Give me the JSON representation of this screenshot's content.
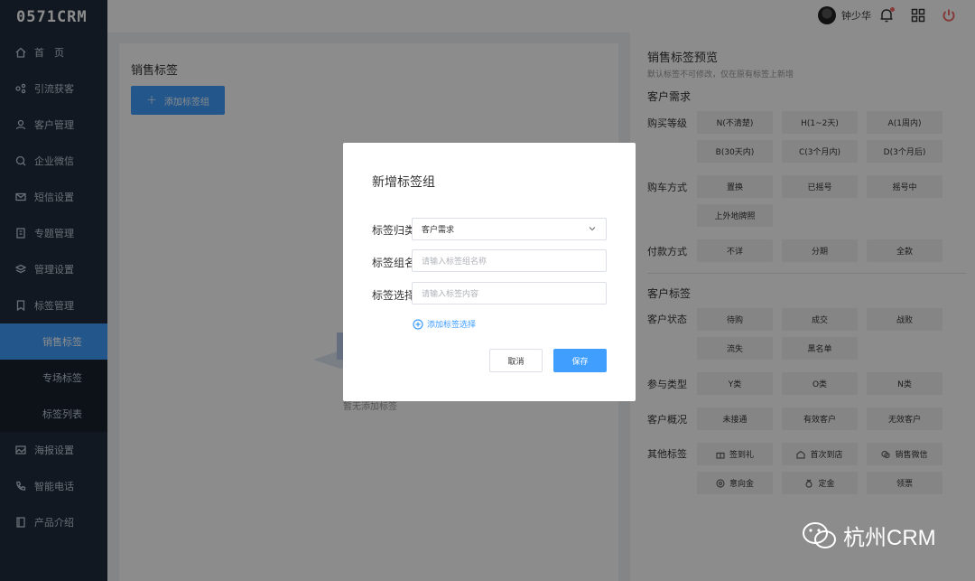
{
  "app": {
    "logo": "0571CRM"
  },
  "sidebar": {
    "items": [
      {
        "label": "首　页",
        "icon": "home-icon"
      },
      {
        "label": "引流获客",
        "icon": "share-icon"
      },
      {
        "label": "客户管理",
        "icon": "user-icon"
      },
      {
        "label": "企业微信",
        "icon": "chat-icon"
      },
      {
        "label": "短信设置",
        "icon": "mail-icon"
      },
      {
        "label": "专题管理",
        "icon": "doc-icon"
      },
      {
        "label": "管理设置",
        "icon": "layers-icon"
      },
      {
        "label": "标签管理",
        "icon": "tag-icon"
      }
    ],
    "submenu": [
      {
        "label": "销售标签",
        "active": true
      },
      {
        "label": "专场标签",
        "active": false
      },
      {
        "label": "标签列表",
        "active": false
      }
    ],
    "items_after": [
      {
        "label": "海报设置",
        "icon": "image-icon"
      },
      {
        "label": "智能电话",
        "icon": "phone-icon"
      },
      {
        "label": "产品介绍",
        "icon": "book-icon"
      }
    ]
  },
  "topbar": {
    "username": "钟少华"
  },
  "main": {
    "title": "销售标签",
    "add_group_label": "添加标签组",
    "empty_text": "暂无添加标签"
  },
  "preview": {
    "title": "销售标签预览",
    "subtitle": "默认标签不可修改，仅在原有标签上新增",
    "section1": "客户需求",
    "buy_level": {
      "label": "购买等级",
      "tags": [
        "N(不清楚)",
        "H(1~2天)",
        "A(1周内)",
        "B(30天内)",
        "C(3个月内)",
        "D(3个月后)"
      ]
    },
    "buy_method": {
      "label": "购车方式",
      "tags": [
        "置换",
        "已摇号",
        "摇号中",
        "上外地牌照"
      ]
    },
    "pay_method": {
      "label": "付款方式",
      "tags": [
        "不详",
        "分期",
        "全款"
      ]
    },
    "section2": "客户标签",
    "cust_status": {
      "label": "客户状态",
      "tags": [
        "待购",
        "成交",
        "战败",
        "流失",
        "黑名单"
      ]
    },
    "join_type": {
      "label": "参与类型",
      "tags": [
        "Y类",
        "O类",
        "N类"
      ]
    },
    "cust_overview": {
      "label": "客户概况",
      "tags": [
        "未接通",
        "有效客户",
        "无效客户"
      ]
    },
    "other": {
      "label": "其他标签",
      "tags": [
        "签到礼",
        "首次到店",
        "销售微信",
        "意向金",
        "定金",
        "领票"
      ]
    }
  },
  "modal": {
    "title": "新增标签组",
    "category_label": "标签归类",
    "category_value": "客户需求",
    "name_label": "标签组名",
    "name_placeholder": "请输入标签组名称",
    "select_label": "标签选择",
    "select_placeholder": "请输入标签内容",
    "add_select_label": "添加标签选择",
    "cancel_label": "取消",
    "save_label": "保存"
  },
  "watermark": {
    "text": "杭州CRM"
  },
  "colors": {
    "primary": "#409eff",
    "sidebar": "#1f2d3d",
    "danger": "#f56c6c"
  }
}
